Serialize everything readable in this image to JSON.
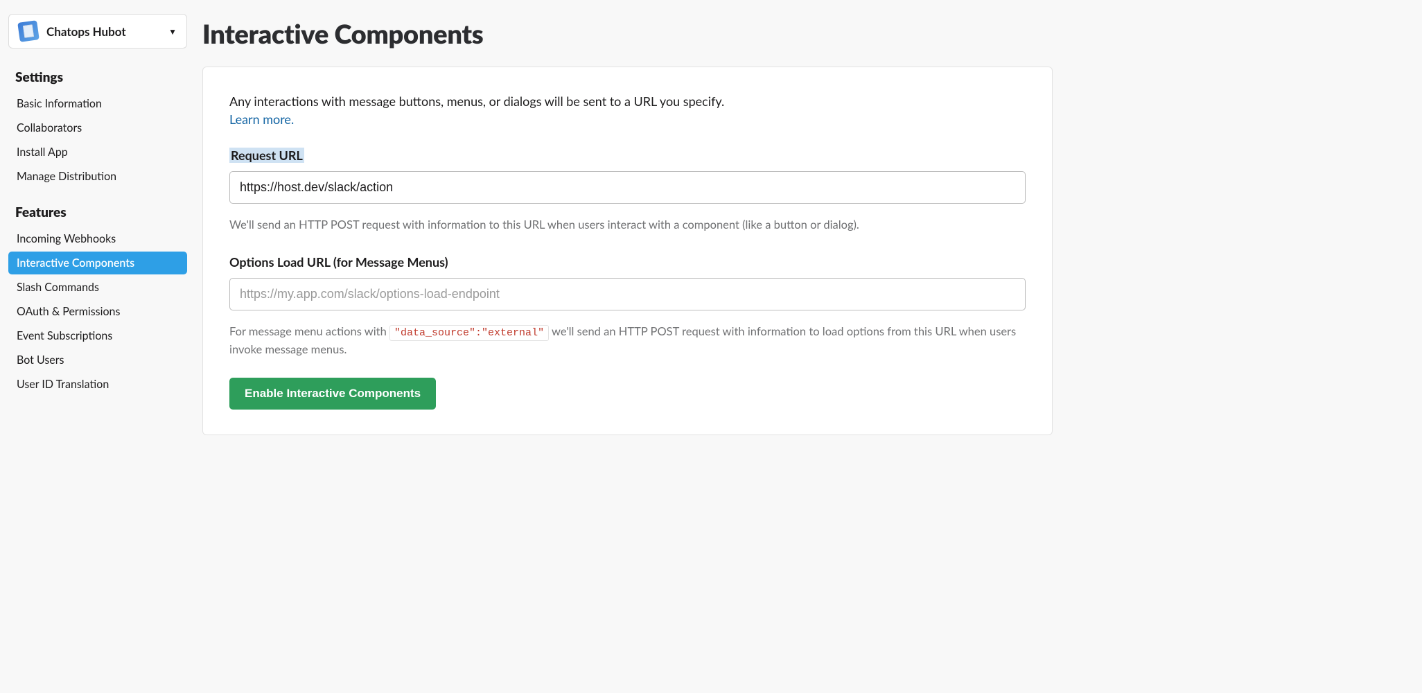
{
  "app_selector": {
    "name": "Chatops Hubot"
  },
  "sidebar": {
    "settings_heading": "Settings",
    "features_heading": "Features",
    "settings_items": [
      {
        "label": "Basic Information"
      },
      {
        "label": "Collaborators"
      },
      {
        "label": "Install App"
      },
      {
        "label": "Manage Distribution"
      }
    ],
    "features_items": [
      {
        "label": "Incoming Webhooks"
      },
      {
        "label": "Interactive Components",
        "active": true
      },
      {
        "label": "Slash Commands"
      },
      {
        "label": "OAuth & Permissions"
      },
      {
        "label": "Event Subscriptions"
      },
      {
        "label": "Bot Users"
      },
      {
        "label": "User ID Translation"
      }
    ]
  },
  "page": {
    "title": "Interactive Components",
    "intro": "Any interactions with message buttons, menus, or dialogs will be sent to a URL you specify.",
    "learn_more": "Learn more.",
    "request_url": {
      "label": "Request URL",
      "value": "https://host.dev/slack/action",
      "help": "We'll send an HTTP POST request with information to this URL when users interact with a component (like a button or dialog)."
    },
    "options_url": {
      "label": "Options Load URL (for Message Menus)",
      "placeholder": "https://my.app.com/slack/options-load-endpoint",
      "help_prefix": "For message menu actions with ",
      "code": "\"data_source\":\"external\"",
      "help_suffix": " we'll send an HTTP POST request with information to load options from this URL when users invoke message menus."
    },
    "enable_button": "Enable Interactive Components"
  }
}
